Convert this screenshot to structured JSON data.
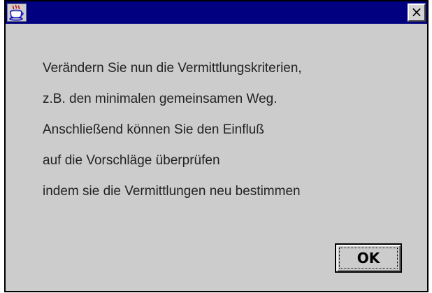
{
  "window": {
    "title": "",
    "icon": "java-coffee-cup-icon",
    "close_glyph": "×",
    "colors": {
      "titlebar": "#000080",
      "background": "#cccccc"
    }
  },
  "message": {
    "lines": [
      "Verändern Sie nun die Vermittlungskriterien,",
      "z.B. den minimalen gemeinsamen Weg.",
      "Anschließend können Sie den Einfluß",
      "auf die Vorschläge überprüfen",
      "indem sie die Vermittlungen neu bestimmen"
    ]
  },
  "buttons": {
    "ok_label": "OK"
  }
}
